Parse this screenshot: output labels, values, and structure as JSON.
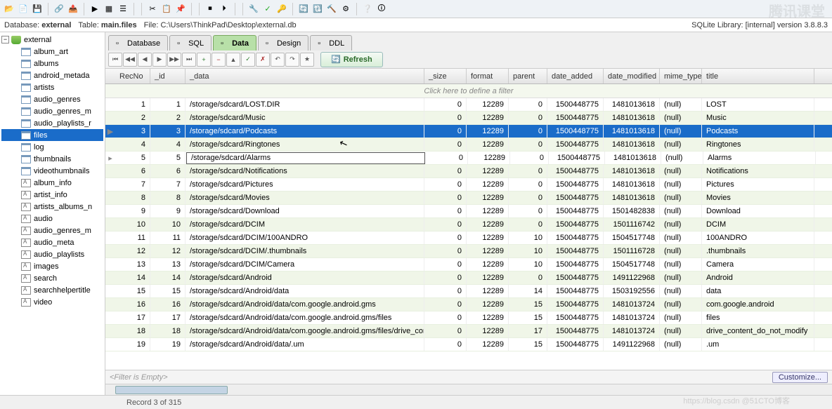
{
  "info": {
    "db_label": "Database:",
    "db_value": "external",
    "table_label": "Table:",
    "table_value": "main.files",
    "file_label": "File:",
    "file_value": "C:\\Users\\ThinkPad\\Desktop\\external.db",
    "lib_label": "SQLite Library: [internal] version 3.8.8.3"
  },
  "tree": {
    "root": "external",
    "items": [
      "album_art",
      "albums",
      "android_metada",
      "artists",
      "audio_genres",
      "audio_genres_m",
      "audio_playlists_r",
      "files",
      "log",
      "thumbnails",
      "videothumbnails",
      "album_info",
      "artist_info",
      "artists_albums_n",
      "audio",
      "audio_genres_m",
      "audio_meta",
      "audio_playlists",
      "images",
      "search",
      "searchhelpertitle",
      "video"
    ],
    "selected_idx": 7,
    "view_start": 11
  },
  "tabs": [
    {
      "label": "Database",
      "icon": "db"
    },
    {
      "label": "SQL",
      "icon": "sql"
    },
    {
      "label": "Data",
      "icon": "data"
    },
    {
      "label": "Design",
      "icon": "design"
    },
    {
      "label": "DDL",
      "icon": "ddl"
    }
  ],
  "tabs_active": 2,
  "nav": {
    "refresh": "Refresh"
  },
  "columns": [
    "RecNo",
    "_id",
    "_data",
    "_size",
    "format",
    "parent",
    "date_added",
    "date_modified",
    "mime_type",
    "title"
  ],
  "filter_hint": "Click here to define a filter",
  "rows": [
    {
      "recno": 1,
      "id": 1,
      "data": "/storage/sdcard/LOST.DIR",
      "size": 0,
      "format": 12289,
      "parent": 0,
      "date_added": 1500448775,
      "date_modified": 1481013618,
      "mime": "(null)",
      "title": "LOST"
    },
    {
      "recno": 2,
      "id": 2,
      "data": "/storage/sdcard/Music",
      "size": 0,
      "format": 12289,
      "parent": 0,
      "date_added": 1500448775,
      "date_modified": 1481013618,
      "mime": "(null)",
      "title": "Music"
    },
    {
      "recno": 3,
      "id": 3,
      "data": "/storage/sdcard/Podcasts",
      "size": 0,
      "format": 12289,
      "parent": 0,
      "date_added": 1500448775,
      "date_modified": 1481013618,
      "mime": "(null)",
      "title": "Podcasts"
    },
    {
      "recno": 4,
      "id": 4,
      "data": "/storage/sdcard/Ringtones",
      "size": 0,
      "format": 12289,
      "parent": 0,
      "date_added": 1500448775,
      "date_modified": 1481013618,
      "mime": "(null)",
      "title": "Ringtones"
    },
    {
      "recno": 5,
      "id": 5,
      "data": "/storage/sdcard/Alarms",
      "size": 0,
      "format": 12289,
      "parent": 0,
      "date_added": 1500448775,
      "date_modified": 1481013618,
      "mime": "(null)",
      "title": "Alarms"
    },
    {
      "recno": 6,
      "id": 6,
      "data": "/storage/sdcard/Notifications",
      "size": 0,
      "format": 12289,
      "parent": 0,
      "date_added": 1500448775,
      "date_modified": 1481013618,
      "mime": "(null)",
      "title": "Notifications"
    },
    {
      "recno": 7,
      "id": 7,
      "data": "/storage/sdcard/Pictures",
      "size": 0,
      "format": 12289,
      "parent": 0,
      "date_added": 1500448775,
      "date_modified": 1481013618,
      "mime": "(null)",
      "title": "Pictures"
    },
    {
      "recno": 8,
      "id": 8,
      "data": "/storage/sdcard/Movies",
      "size": 0,
      "format": 12289,
      "parent": 0,
      "date_added": 1500448775,
      "date_modified": 1481013618,
      "mime": "(null)",
      "title": "Movies"
    },
    {
      "recno": 9,
      "id": 9,
      "data": "/storage/sdcard/Download",
      "size": 0,
      "format": 12289,
      "parent": 0,
      "date_added": 1500448775,
      "date_modified": 1501482838,
      "mime": "(null)",
      "title": "Download"
    },
    {
      "recno": 10,
      "id": 10,
      "data": "/storage/sdcard/DCIM",
      "size": 0,
      "format": 12289,
      "parent": 0,
      "date_added": 1500448775,
      "date_modified": 1501116742,
      "mime": "(null)",
      "title": "DCIM"
    },
    {
      "recno": 11,
      "id": 11,
      "data": "/storage/sdcard/DCIM/100ANDRO",
      "size": 0,
      "format": 12289,
      "parent": 10,
      "date_added": 1500448775,
      "date_modified": 1504517748,
      "mime": "(null)",
      "title": "100ANDRO"
    },
    {
      "recno": 12,
      "id": 12,
      "data": "/storage/sdcard/DCIM/.thumbnails",
      "size": 0,
      "format": 12289,
      "parent": 10,
      "date_added": 1500448775,
      "date_modified": 1501116728,
      "mime": "(null)",
      "title": ".thumbnails"
    },
    {
      "recno": 13,
      "id": 13,
      "data": "/storage/sdcard/DCIM/Camera",
      "size": 0,
      "format": 12289,
      "parent": 10,
      "date_added": 1500448775,
      "date_modified": 1504517748,
      "mime": "(null)",
      "title": "Camera"
    },
    {
      "recno": 14,
      "id": 14,
      "data": "/storage/sdcard/Android",
      "size": 0,
      "format": 12289,
      "parent": 0,
      "date_added": 1500448775,
      "date_modified": 1491122968,
      "mime": "(null)",
      "title": "Android"
    },
    {
      "recno": 15,
      "id": 15,
      "data": "/storage/sdcard/Android/data",
      "size": 0,
      "format": 12289,
      "parent": 14,
      "date_added": 1500448775,
      "date_modified": 1503192556,
      "mime": "(null)",
      "title": "data"
    },
    {
      "recno": 16,
      "id": 16,
      "data": "/storage/sdcard/Android/data/com.google.android.gms",
      "size": 0,
      "format": 12289,
      "parent": 15,
      "date_added": 1500448775,
      "date_modified": 1481013724,
      "mime": "(null)",
      "title": "com.google.android"
    },
    {
      "recno": 17,
      "id": 17,
      "data": "/storage/sdcard/Android/data/com.google.android.gms/files",
      "size": 0,
      "format": 12289,
      "parent": 15,
      "date_added": 1500448775,
      "date_modified": 1481013724,
      "mime": "(null)",
      "title": "files"
    },
    {
      "recno": 18,
      "id": 18,
      "data": "/storage/sdcard/Android/data/com.google.android.gms/files/drive_content_do_not_modify",
      "size": 0,
      "format": 12289,
      "parent": 17,
      "date_added": 1500448775,
      "date_modified": 1481013724,
      "mime": "(null)",
      "title": "drive_content_do_not_modify"
    },
    {
      "recno": 19,
      "id": 19,
      "data": "/storage/sdcard/Android/data/.um",
      "size": 0,
      "format": 12289,
      "parent": 15,
      "date_added": 1500448775,
      "date_modified": 1491122968,
      "mime": "(null)",
      "title": ".um"
    }
  ],
  "selected_row": 2,
  "editing_row": 4,
  "filter_empty": "<Filter is Empty>",
  "customize": "Customize...",
  "status": "Record 3 of 315",
  "watermark": "腾讯课堂",
  "watermark2": "https://blog.csdn    @51CTO博客"
}
